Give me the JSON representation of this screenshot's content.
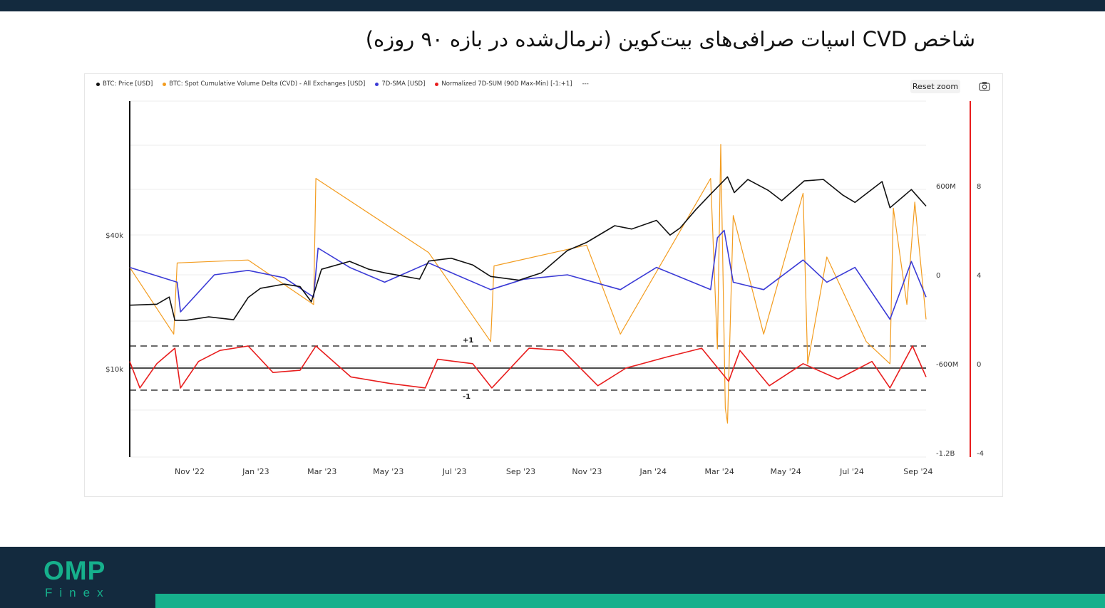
{
  "page": {
    "title": "شاخص CVD اسپات صرافی‌های بیت‌کوین (نرمال‌شده در بازه ۹۰ روزه)"
  },
  "toolbar": {
    "reset_zoom_label": "Reset zoom",
    "camera_icon": "camera-icon"
  },
  "logo": {
    "main": "OMP",
    "sub": "Finex"
  },
  "colors": {
    "price": "#111111",
    "cvd": "#f39c1f",
    "sma": "#3b3bd6",
    "normalized": "#e81d1d",
    "brand": "#16b08c",
    "navy": "#132a3e"
  },
  "chart_data": {
    "type": "line",
    "legend": [
      {
        "label": "BTC: Price [USD]",
        "color": "#111111"
      },
      {
        "label": "BTC: Spot Cumulative Volume Delta (CVD) - All Exchanges [USD]",
        "color": "#f39c1f"
      },
      {
        "label": "7D-SMA [USD]",
        "color": "#3b3bd6"
      },
      {
        "label": "Normalized 7D-SUM (90D Max-Min) [-1:+1]",
        "color": "#e81d1d"
      },
      {
        "label": "---",
        "color": ""
      }
    ],
    "legend_position": "top-left",
    "x_ticks": [
      "Nov '22",
      "Jan '23",
      "Mar '23",
      "May '23",
      "Jul '23",
      "Sep '23",
      "Nov '23",
      "Jan '24",
      "Mar '24",
      "May '24",
      "Jul '24",
      "Sep '24"
    ],
    "x_range": [
      "2022-10-01",
      "2024-09-06"
    ],
    "price_axis": {
      "scale": "log",
      "ticks": [
        "$40k",
        "$10k"
      ],
      "tick_values": [
        40000,
        10000
      ]
    },
    "cvd_axis": {
      "ticks": [
        "600M",
        "0",
        "-600M",
        "-1.2B"
      ],
      "tick_values": [
        600000000,
        0,
        -600000000,
        -1200000000
      ]
    },
    "normalized_axis": {
      "ticks": [
        "8",
        "4",
        "0",
        "-4"
      ],
      "tick_values": [
        8,
        4,
        0,
        -4
      ]
    },
    "annotations": [
      "+1",
      "-1"
    ],
    "reference_lines": [
      1,
      0,
      -1
    ],
    "grid": true,
    "series": [
      {
        "name": "BTC: Price [USD]",
        "axis": "price",
        "x": [
          "2022-10-01",
          "2022-10-25",
          "2022-11-05",
          "2022-11-10",
          "2022-11-20",
          "2022-12-10",
          "2023-01-01",
          "2023-01-14",
          "2023-01-25",
          "2023-02-15",
          "2023-03-01",
          "2023-03-11",
          "2023-03-20",
          "2023-04-14",
          "2023-05-01",
          "2023-05-15",
          "2023-06-15",
          "2023-06-23",
          "2023-07-13",
          "2023-08-01",
          "2023-08-17",
          "2023-09-11",
          "2023-10-01",
          "2023-10-24",
          "2023-11-10",
          "2023-12-05",
          "2023-12-20",
          "2024-01-11",
          "2024-01-23",
          "2024-02-01",
          "2024-02-15",
          "2024-02-28",
          "2024-03-14",
          "2024-03-20",
          "2024-04-01",
          "2024-04-19",
          "2024-05-01",
          "2024-05-21",
          "2024-06-07",
          "2024-06-24",
          "2024-07-05",
          "2024-07-29",
          "2024-08-05",
          "2024-08-24",
          "2024-09-06"
        ],
        "y": [
          19300,
          19500,
          21000,
          16500,
          16500,
          17100,
          16600,
          20900,
          23000,
          24000,
          23400,
          20000,
          28000,
          30400,
          28000,
          27000,
          25300,
          30500,
          31400,
          29300,
          26000,
          25000,
          27000,
          34000,
          37000,
          44000,
          42500,
          46500,
          39900,
          43000,
          52000,
          61000,
          73000,
          62000,
          71000,
          63500,
          57000,
          70000,
          71000,
          60500,
          56000,
          69500,
          53000,
          64000,
          53900
        ]
      },
      {
        "name": "BTC: Spot Cumulative Volume Delta (CVD) - All Exchanges [USD]",
        "axis": "cvd",
        "x": [
          "2022-10-01",
          "2022-11-09",
          "2022-11-12",
          "2023-01-14",
          "2023-03-13",
          "2023-03-15",
          "2023-06-23",
          "2023-08-17",
          "2023-08-20",
          "2023-11-10",
          "2023-12-10",
          "2024-02-28",
          "2024-03-05",
          "2024-03-08",
          "2024-03-12",
          "2024-03-14",
          "2024-03-19",
          "2024-04-15",
          "2024-05-20",
          "2024-05-24",
          "2024-06-10",
          "2024-07-15",
          "2024-08-05",
          "2024-08-08",
          "2024-08-20",
          "2024-08-27",
          "2024-09-06"
        ],
        "y": [
          50000000,
          -400000000,
          80000000,
          100000000,
          -200000000,
          650000000,
          150000000,
          -450000000,
          60000000,
          200000000,
          -400000000,
          650000000,
          -500000000,
          880000000,
          -900000000,
          -1000000000,
          400000000,
          -400000000,
          550000000,
          -600000000,
          120000000,
          -450000000,
          -600000000,
          450000000,
          -200000000,
          490000000,
          -300000000
        ]
      },
      {
        "name": "7D-SMA [USD]",
        "axis": "cvd",
        "x": [
          "2022-10-01",
          "2022-11-12",
          "2022-11-15",
          "2022-12-15",
          "2023-01-14",
          "2023-02-15",
          "2023-03-13",
          "2023-03-17",
          "2023-04-14",
          "2023-05-15",
          "2023-06-23",
          "2023-08-17",
          "2023-09-15",
          "2023-10-24",
          "2023-12-10",
          "2024-01-11",
          "2024-02-28",
          "2024-03-05",
          "2024-03-11",
          "2024-03-19",
          "2024-04-15",
          "2024-05-20",
          "2024-06-10",
          "2024-07-05",
          "2024-08-05",
          "2024-08-24",
          "2024-09-06"
        ],
        "y": [
          50000000,
          -50000000,
          -250000000,
          0,
          30000000,
          -20000000,
          -150000000,
          180000000,
          50000000,
          -50000000,
          80000000,
          -100000000,
          -30000000,
          0,
          -100000000,
          50000000,
          -100000000,
          250000000,
          300000000,
          -50000000,
          -100000000,
          100000000,
          -50000000,
          50000000,
          -300000000,
          90000000,
          -150000000
        ]
      },
      {
        "name": "Normalized 7D-SUM (90D Max-Min) [-1:+1]",
        "axis": "normalized",
        "x": [
          "2022-10-01",
          "2022-10-10",
          "2022-10-25",
          "2022-11-10",
          "2022-11-15",
          "2022-12-01",
          "2022-12-20",
          "2023-01-14",
          "2023-02-05",
          "2023-03-01",
          "2023-03-15",
          "2023-04-15",
          "2023-05-20",
          "2023-06-20",
          "2023-07-01",
          "2023-08-01",
          "2023-08-18",
          "2023-09-20",
          "2023-10-20",
          "2023-11-20",
          "2023-12-15",
          "2024-01-20",
          "2024-02-20",
          "2024-03-15",
          "2024-03-25",
          "2024-04-20",
          "2024-05-20",
          "2024-06-20",
          "2024-07-20",
          "2024-08-05",
          "2024-08-25",
          "2024-09-06"
        ],
        "y": [
          0.3,
          -0.9,
          0.2,
          0.9,
          -0.9,
          0.3,
          0.8,
          1.0,
          -0.2,
          -0.1,
          1.0,
          -0.4,
          -0.7,
          -0.9,
          0.4,
          0.2,
          -0.9,
          0.9,
          0.8,
          -0.8,
          0.0,
          0.5,
          0.9,
          -0.6,
          0.8,
          -0.8,
          0.2,
          -0.5,
          0.3,
          -0.9,
          1.0,
          -0.4
        ]
      }
    ]
  }
}
